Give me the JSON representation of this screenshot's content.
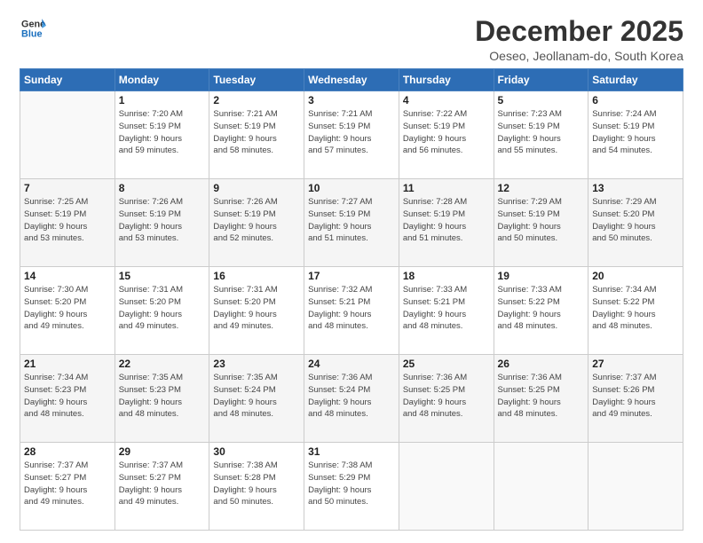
{
  "logo": {
    "line1": "General",
    "line2": "Blue"
  },
  "title": "December 2025",
  "subtitle": "Oeseo, Jeollanam-do, South Korea",
  "days_header": [
    "Sunday",
    "Monday",
    "Tuesday",
    "Wednesday",
    "Thursday",
    "Friday",
    "Saturday"
  ],
  "weeks": [
    [
      {
        "num": "",
        "info": ""
      },
      {
        "num": "1",
        "info": "Sunrise: 7:20 AM\nSunset: 5:19 PM\nDaylight: 9 hours\nand 59 minutes."
      },
      {
        "num": "2",
        "info": "Sunrise: 7:21 AM\nSunset: 5:19 PM\nDaylight: 9 hours\nand 58 minutes."
      },
      {
        "num": "3",
        "info": "Sunrise: 7:21 AM\nSunset: 5:19 PM\nDaylight: 9 hours\nand 57 minutes."
      },
      {
        "num": "4",
        "info": "Sunrise: 7:22 AM\nSunset: 5:19 PM\nDaylight: 9 hours\nand 56 minutes."
      },
      {
        "num": "5",
        "info": "Sunrise: 7:23 AM\nSunset: 5:19 PM\nDaylight: 9 hours\nand 55 minutes."
      },
      {
        "num": "6",
        "info": "Sunrise: 7:24 AM\nSunset: 5:19 PM\nDaylight: 9 hours\nand 54 minutes."
      }
    ],
    [
      {
        "num": "7",
        "info": "Sunrise: 7:25 AM\nSunset: 5:19 PM\nDaylight: 9 hours\nand 53 minutes."
      },
      {
        "num": "8",
        "info": "Sunrise: 7:26 AM\nSunset: 5:19 PM\nDaylight: 9 hours\nand 53 minutes."
      },
      {
        "num": "9",
        "info": "Sunrise: 7:26 AM\nSunset: 5:19 PM\nDaylight: 9 hours\nand 52 minutes."
      },
      {
        "num": "10",
        "info": "Sunrise: 7:27 AM\nSunset: 5:19 PM\nDaylight: 9 hours\nand 51 minutes."
      },
      {
        "num": "11",
        "info": "Sunrise: 7:28 AM\nSunset: 5:19 PM\nDaylight: 9 hours\nand 51 minutes."
      },
      {
        "num": "12",
        "info": "Sunrise: 7:29 AM\nSunset: 5:19 PM\nDaylight: 9 hours\nand 50 minutes."
      },
      {
        "num": "13",
        "info": "Sunrise: 7:29 AM\nSunset: 5:20 PM\nDaylight: 9 hours\nand 50 minutes."
      }
    ],
    [
      {
        "num": "14",
        "info": "Sunrise: 7:30 AM\nSunset: 5:20 PM\nDaylight: 9 hours\nand 49 minutes."
      },
      {
        "num": "15",
        "info": "Sunrise: 7:31 AM\nSunset: 5:20 PM\nDaylight: 9 hours\nand 49 minutes."
      },
      {
        "num": "16",
        "info": "Sunrise: 7:31 AM\nSunset: 5:20 PM\nDaylight: 9 hours\nand 49 minutes."
      },
      {
        "num": "17",
        "info": "Sunrise: 7:32 AM\nSunset: 5:21 PM\nDaylight: 9 hours\nand 48 minutes."
      },
      {
        "num": "18",
        "info": "Sunrise: 7:33 AM\nSunset: 5:21 PM\nDaylight: 9 hours\nand 48 minutes."
      },
      {
        "num": "19",
        "info": "Sunrise: 7:33 AM\nSunset: 5:22 PM\nDaylight: 9 hours\nand 48 minutes."
      },
      {
        "num": "20",
        "info": "Sunrise: 7:34 AM\nSunset: 5:22 PM\nDaylight: 9 hours\nand 48 minutes."
      }
    ],
    [
      {
        "num": "21",
        "info": "Sunrise: 7:34 AM\nSunset: 5:23 PM\nDaylight: 9 hours\nand 48 minutes."
      },
      {
        "num": "22",
        "info": "Sunrise: 7:35 AM\nSunset: 5:23 PM\nDaylight: 9 hours\nand 48 minutes."
      },
      {
        "num": "23",
        "info": "Sunrise: 7:35 AM\nSunset: 5:24 PM\nDaylight: 9 hours\nand 48 minutes."
      },
      {
        "num": "24",
        "info": "Sunrise: 7:36 AM\nSunset: 5:24 PM\nDaylight: 9 hours\nand 48 minutes."
      },
      {
        "num": "25",
        "info": "Sunrise: 7:36 AM\nSunset: 5:25 PM\nDaylight: 9 hours\nand 48 minutes."
      },
      {
        "num": "26",
        "info": "Sunrise: 7:36 AM\nSunset: 5:25 PM\nDaylight: 9 hours\nand 48 minutes."
      },
      {
        "num": "27",
        "info": "Sunrise: 7:37 AM\nSunset: 5:26 PM\nDaylight: 9 hours\nand 49 minutes."
      }
    ],
    [
      {
        "num": "28",
        "info": "Sunrise: 7:37 AM\nSunset: 5:27 PM\nDaylight: 9 hours\nand 49 minutes."
      },
      {
        "num": "29",
        "info": "Sunrise: 7:37 AM\nSunset: 5:27 PM\nDaylight: 9 hours\nand 49 minutes."
      },
      {
        "num": "30",
        "info": "Sunrise: 7:38 AM\nSunset: 5:28 PM\nDaylight: 9 hours\nand 50 minutes."
      },
      {
        "num": "31",
        "info": "Sunrise: 7:38 AM\nSunset: 5:29 PM\nDaylight: 9 hours\nand 50 minutes."
      },
      {
        "num": "",
        "info": ""
      },
      {
        "num": "",
        "info": ""
      },
      {
        "num": "",
        "info": ""
      }
    ]
  ]
}
